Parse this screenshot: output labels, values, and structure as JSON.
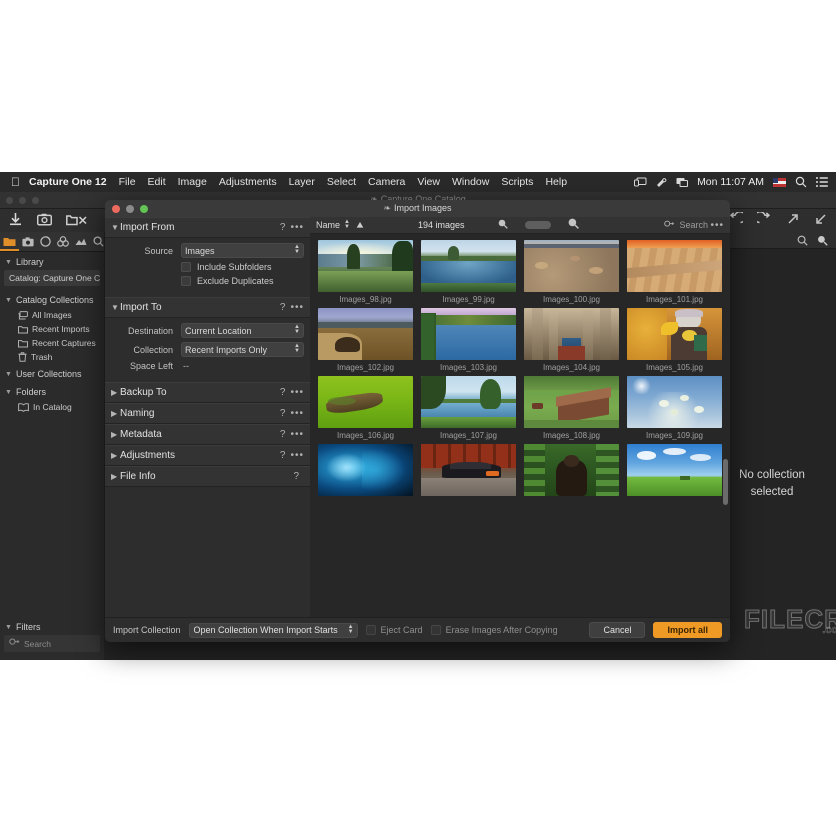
{
  "menubar": {
    "apple_icon": "apple-icon",
    "app_name": "Capture One 12",
    "items": [
      "File",
      "Edit",
      "Image",
      "Adjustments",
      "Layer",
      "Select",
      "Camera",
      "View",
      "Window",
      "Scripts",
      "Help"
    ],
    "status_icons": [
      "screen-mirroring-icon",
      "vpn-icon",
      "displays-icon"
    ],
    "clock": "Mon 11:07 AM",
    "flag_icon": "us-flag-icon",
    "search_icon": "spotlight-search-icon",
    "control_center_icon": "control-center-icon"
  },
  "app_window": {
    "title": "Capture One Catalog",
    "title_icon": "capture-one-icon",
    "toolbar_left_icons": [
      "import-icon",
      "capture-icon",
      "delete-folder-icon"
    ],
    "toolbar_right_icons": [
      "copy-apply-icon",
      "undo-icon",
      "redo-icon",
      "zoom-in-arrow-icon",
      "zoom-out-arrow-icon"
    ],
    "viewer_toolbar_icons": [
      "search-icon",
      "magnifier-icon"
    ],
    "no_collection_text": "No collection\nselected",
    "no_collection_line1": "No collection",
    "no_collection_line2": "selected",
    "watermark": "FILECR",
    "watermark_sub": ".com"
  },
  "library": {
    "tool_tabs": [
      "library-tab",
      "capture-tab",
      "lens-tab",
      "color-tab",
      "exposure-tab",
      "details-tab"
    ],
    "active_tool_tab": "library-tab",
    "section_title": "Library",
    "catalog_pill": "Catalog: Capture One Ca",
    "catalog_collections_title": "Catalog Collections",
    "catalog_collections": [
      {
        "label": "All Images",
        "icon": "images-folder-icon"
      },
      {
        "label": "Recent Imports",
        "icon": "folder-icon"
      },
      {
        "label": "Recent Captures",
        "icon": "folder-icon"
      },
      {
        "label": "Trash",
        "icon": "trash-icon"
      }
    ],
    "user_collections_title": "User Collections",
    "folders_title": "Folders",
    "folders": [
      {
        "label": "In Catalog",
        "icon": "catalog-icon"
      }
    ],
    "filters_title": "Filters",
    "filters_search_placeholder": "Search",
    "filters_search_icon": "search-icon"
  },
  "dialog": {
    "title": "Import Images",
    "title_icon": "capture-one-icon",
    "traffic_lights": [
      "close",
      "minimize",
      "zoom"
    ],
    "sections": [
      {
        "id": "import-from",
        "label": "Import From",
        "expanded": true,
        "help": "?",
        "menu": "•••",
        "fields": [
          {
            "type": "select",
            "label": "Source",
            "value": "Images"
          },
          {
            "type": "checkbox",
            "label": "Include Subfolders",
            "checked": false
          },
          {
            "type": "checkbox",
            "label": "Exclude Duplicates",
            "checked": false
          }
        ]
      },
      {
        "id": "import-to",
        "label": "Import To",
        "expanded": true,
        "help": "?",
        "menu": "•••",
        "fields": [
          {
            "type": "select",
            "label": "Destination",
            "value": "Current Location"
          },
          {
            "type": "select",
            "label": "Collection",
            "value": "Recent Imports Only"
          },
          {
            "type": "static",
            "label": "Space Left",
            "value": "--"
          }
        ]
      },
      {
        "id": "backup-to",
        "label": "Backup To",
        "expanded": false,
        "help": "?",
        "menu": "•••"
      },
      {
        "id": "naming",
        "label": "Naming",
        "expanded": false,
        "help": "?",
        "menu": "•••"
      },
      {
        "id": "metadata",
        "label": "Metadata",
        "expanded": false,
        "help": "?",
        "menu": "•••"
      },
      {
        "id": "adjustments",
        "label": "Adjustments",
        "expanded": false,
        "help": "?",
        "menu": "•••"
      },
      {
        "id": "file-info",
        "label": "File Info",
        "expanded": false,
        "help": "?",
        "menu": ""
      }
    ],
    "browser": {
      "sort_label": "Name",
      "sort_direction_icon": "sort-ascending-icon",
      "sort_stepper_icon": "stepper-icon",
      "count": "194 images",
      "zoom_out_icon": "zoom-out-icon",
      "zoom_in_icon": "zoom-in-icon",
      "search_placeholder": "Search",
      "search_icon": "search-filter-icon",
      "menu_icon": "•••"
    },
    "thumbnails": [
      {
        "name": "Images_98.jpg",
        "art": "sunrise-forest"
      },
      {
        "name": "Images_99.jpg",
        "art": "lake-reeds"
      },
      {
        "name": "Images_100.jpg",
        "art": "desert-rocks"
      },
      {
        "name": "Images_101.jpg",
        "art": "canyon-sunset"
      },
      {
        "name": "Images_102.jpg",
        "art": "highland-moor"
      },
      {
        "name": "Images_103.jpg",
        "art": "river-autumn"
      },
      {
        "name": "Images_104.jpg",
        "art": "cathedral-interior"
      },
      {
        "name": "Images_105.jpg",
        "art": "girl-autumn-leaves"
      },
      {
        "name": "Images_106.jpg",
        "art": "log-on-grass"
      },
      {
        "name": "Images_107.jpg",
        "art": "lake-trees"
      },
      {
        "name": "Images_108.jpg",
        "art": "barn-hillside"
      },
      {
        "name": "Images_109.jpg",
        "art": "blossoms-sky"
      },
      {
        "name": "",
        "art": "blue-feather"
      },
      {
        "name": "",
        "art": "car-street"
      },
      {
        "name": "",
        "art": "bear-forest"
      },
      {
        "name": "",
        "art": "green-field-clouds"
      }
    ],
    "footer": {
      "import_collection_label": "Import Collection",
      "import_collection_value": "Open Collection When Import Starts",
      "eject_card_label": "Eject Card",
      "eject_card_checked": false,
      "erase_images_label": "Erase Images After Copying",
      "erase_images_checked": false,
      "cancel_label": "Cancel",
      "import_label": "Import all"
    }
  },
  "colors": {
    "accent": "#f09a26",
    "window_bg": "#2d2d2d",
    "panel_bg": "#2b2b2b",
    "viewer_bg": "#242424",
    "menubar_bg": "#2a2a2a"
  }
}
